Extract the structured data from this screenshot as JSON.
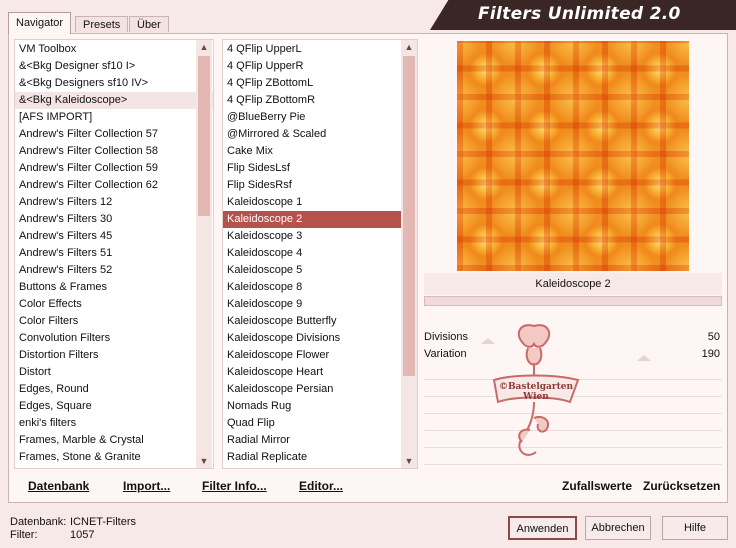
{
  "title": "Filters Unlimited 2.0",
  "tabs": [
    "Navigator",
    "Presets",
    "Über"
  ],
  "categories": [
    "VM Toolbox",
    "&<Bkg Designer sf10 I>",
    "&<Bkg Designers sf10 IV>",
    "&<Bkg Kaleidoscope>",
    "[AFS IMPORT]",
    "Andrew's Filter Collection 57",
    "Andrew's Filter Collection 58",
    "Andrew's Filter Collection 59",
    "Andrew's Filter Collection 62",
    "Andrew's Filters 12",
    "Andrew's Filters 30",
    "Andrew's Filters 45",
    "Andrew's Filters 51",
    "Andrew's Filters 52",
    "Buttons & Frames",
    "Color Effects",
    "Color Filters",
    "Convolution Filters",
    "Distortion Filters",
    "Distort",
    "Edges, Round",
    "Edges, Square",
    "enki's filters",
    "Frames, Marble & Crystal",
    "Frames, Stone & Granite"
  ],
  "filters": [
    "4 QFlip UpperL",
    "4 QFlip UpperR",
    "4 QFlip ZBottomL",
    "4 QFlip ZBottomR",
    "@BlueBerry Pie",
    "@Mirrored & Scaled",
    "Cake Mix",
    "Flip SidesLsf",
    "Flip SidesRsf",
    "Kaleidoscope 1",
    "Kaleidoscope 2",
    "Kaleidoscope 3",
    "Kaleidoscope 4",
    "Kaleidoscope 5",
    "Kaleidoscope 8",
    "Kaleidoscope 9",
    "Kaleidoscope Butterfly",
    "Kaleidoscope Divisions",
    "Kaleidoscope Flower",
    "Kaleidoscope Heart",
    "Kaleidoscope Persian",
    "Nomads Rug",
    "Quad Flip",
    "Radial Mirror",
    "Radial Replicate"
  ],
  "selected_category": "&<Bkg Kaleidoscope>",
  "selected_filter": "Kaleidoscope 2",
  "left_buttons": {
    "database": "Datenbank",
    "import": "Import...",
    "filter_info": "Filter Info...",
    "editor": "Editor..."
  },
  "right_buttons": {
    "random": "Zufallswerte",
    "reset": "Zurücksetzen"
  },
  "preview_filter_name": "Kaleidoscope 2",
  "params": [
    {
      "label": "Divisions",
      "value": "50",
      "level": 0.2
    },
    {
      "label": "Variation",
      "value": "190",
      "level": 0.75
    }
  ],
  "watermark": {
    "line1": "©Bastelgarten",
    "line2": "Wien"
  },
  "status": {
    "db_label": "Datenbank:",
    "db_value": "ICNET-Filters",
    "filter_label": "Filter:",
    "filter_value": "1057"
  },
  "dialog_buttons": {
    "apply": "Anwenden",
    "cancel": "Abbrechen",
    "help": "Hilfe"
  },
  "colors": {
    "accent": "#b5524c",
    "banner": "#3a2624",
    "background": "#f7e9e7"
  }
}
